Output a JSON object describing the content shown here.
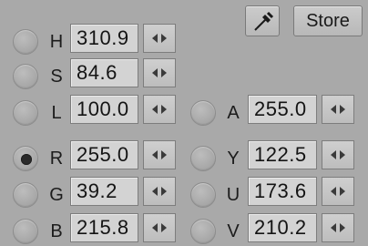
{
  "toolbar": {
    "store_label": "Store",
    "eyedropper_icon": "eyedropper-icon"
  },
  "channels": {
    "H": {
      "label": "H",
      "value": "310.9",
      "selected": false
    },
    "S": {
      "label": "S",
      "value": "84.6",
      "selected": false
    },
    "L": {
      "label": "L",
      "value": "100.0",
      "selected": false
    },
    "A": {
      "label": "A",
      "value": "255.0",
      "selected": false
    },
    "R": {
      "label": "R",
      "value": "255.0",
      "selected": true
    },
    "G": {
      "label": "G",
      "value": "39.2",
      "selected": false
    },
    "B": {
      "label": "B",
      "value": "215.8",
      "selected": false
    },
    "Y": {
      "label": "Y",
      "value": "122.5",
      "selected": false
    },
    "U": {
      "label": "U",
      "value": "173.6",
      "selected": false
    },
    "V": {
      "label": "V",
      "value": "210.2",
      "selected": false
    }
  }
}
